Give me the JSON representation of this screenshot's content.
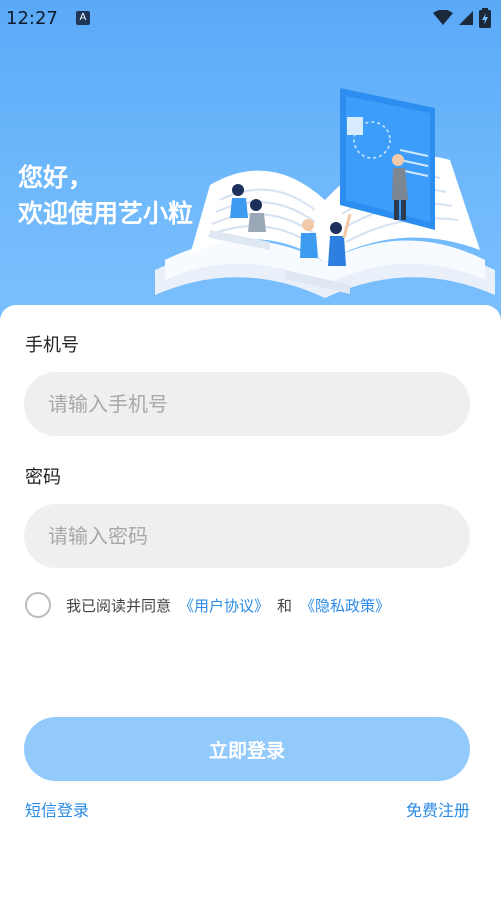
{
  "status_bar": {
    "time": "12:27",
    "app_badge": "A"
  },
  "header": {
    "greeting_line1": "您好，",
    "greeting_line2": "欢迎使用艺小粒"
  },
  "form": {
    "phone_label": "手机号",
    "phone_placeholder": "请输入手机号",
    "password_label": "密码",
    "password_placeholder": "请输入密码",
    "agree_text": "我已阅读并同意",
    "user_agreement": "《用户协议》",
    "and_text": "和",
    "privacy_policy": "《隐私政策》",
    "login_button": "立即登录",
    "sms_login": "短信登录",
    "register": "免费注册"
  },
  "colors": {
    "header_gradient_top": "#5aa9f7",
    "header_gradient_bottom": "#7cc0fc",
    "accent_link": "#2b8be6",
    "login_button_bg": "#93cafc",
    "input_bg": "#efefef"
  }
}
